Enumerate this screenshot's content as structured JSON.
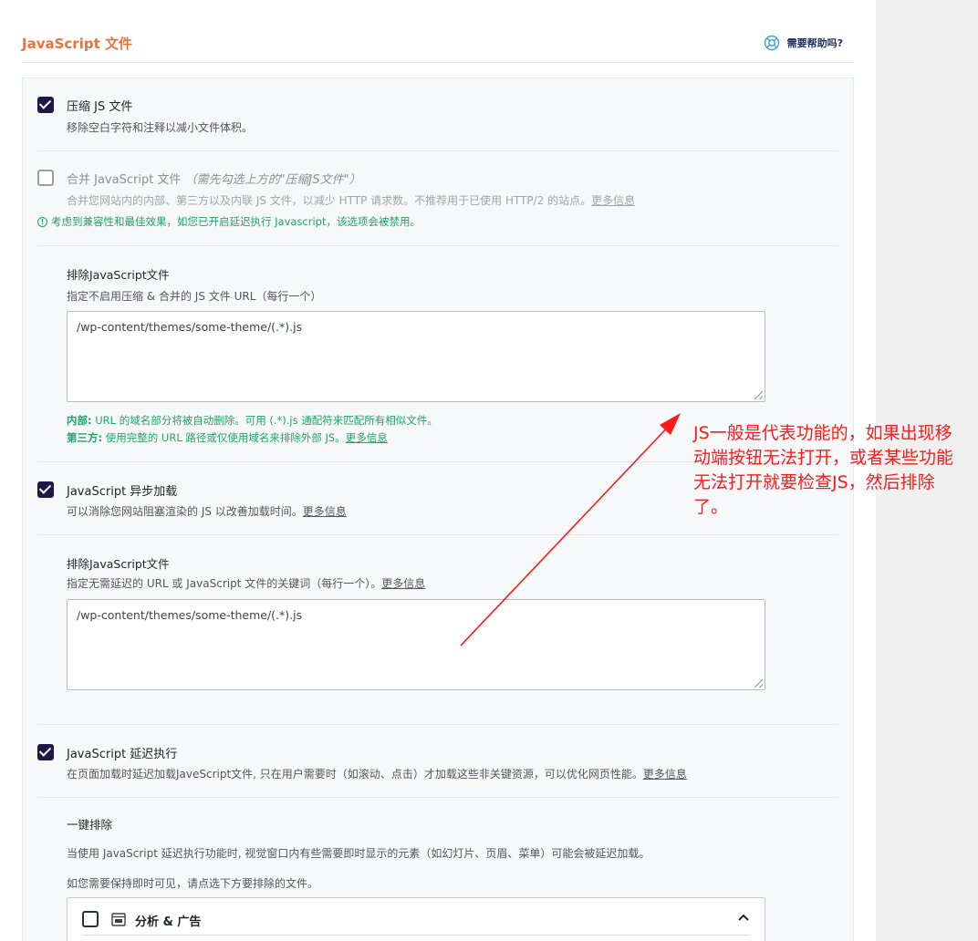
{
  "header": {
    "section_title": "JavaScript 文件",
    "help_label": "需要帮助吗?"
  },
  "minify_js": {
    "checked": true,
    "label": "压缩 JS 文件",
    "description": "移除空白字符和注释以减小文件体积。"
  },
  "combine_js": {
    "checked": false,
    "label": "合并 JavaScript 文件",
    "label_note": "（需先勾选上方的\"压缩JS文件\"）",
    "description": "合并您网站内的内部、第三方以及内联 JS 文件，以减少 HTTP 请求数。不推荐用于已使用 HTTP/2 的站点。",
    "more_link": "更多信息",
    "notice": "考虑到兼容性和最佳效果，如您已开启延迟执行 Javascript，该选项会被禁用。"
  },
  "exclude_minify": {
    "title": "排除JavaScript文件",
    "description": "指定不启用压缩 & 合并的 JS 文件 URL（每行一个）",
    "textarea_value": "/wp-content/themes/some-theme/(.*).js",
    "internal_label": "内部:",
    "internal_text": "URL 的域名部分将被自动删除。可用 (.*).js 通配符来匹配所有相似文件。",
    "third_party_label": "第三方:",
    "third_party_text": "使用完整的 URL 路径或仅使用域名来排除外部 JS。",
    "more_link": "更多信息"
  },
  "async_js": {
    "checked": true,
    "label": "JavaScript 异步加载",
    "description": "可以消除您网站阻塞渲染的 JS 以改善加载时间。",
    "more_link": "更多信息"
  },
  "exclude_async": {
    "title": "排除JavaScript文件",
    "description": "指定无需延迟的 URL 或 JavaScript 文件的关键词（每行一个）。",
    "more_link": "更多信息",
    "textarea_value": "/wp-content/themes/some-theme/(.*).js"
  },
  "delay_js": {
    "checked": true,
    "label": "JavaScript 延迟执行",
    "description": "在页面加载时延迟加载JaveScript文件, 只在用户需要时（如滚动、点击）才加载这些非关键资源，可以优化网页性能。",
    "more_link": "更多信息"
  },
  "one_click_exclusion": {
    "title": "一键排除",
    "line1": "当使用 JavaScript 延迟执行功能时, 视觉窗口内有些需要即时显示的元素（如幻灯片、页眉、菜单）可能会被延迟加载。",
    "line2": "如您需要保持即时可见，请点选下方要排除的文件。",
    "group_label": "分析 & 广告",
    "group_checked": false
  },
  "annotation": {
    "text": "JS一般是代表功能的，如果出现移动端按钮无法打开，或者某些功能无法打开就要检查JS，然后排除了。",
    "color": "#ff1a1a"
  },
  "colors": {
    "accent_orange": "#e8723a",
    "checkbox_navy": "#1c1847",
    "notice_green": "#21a366"
  }
}
